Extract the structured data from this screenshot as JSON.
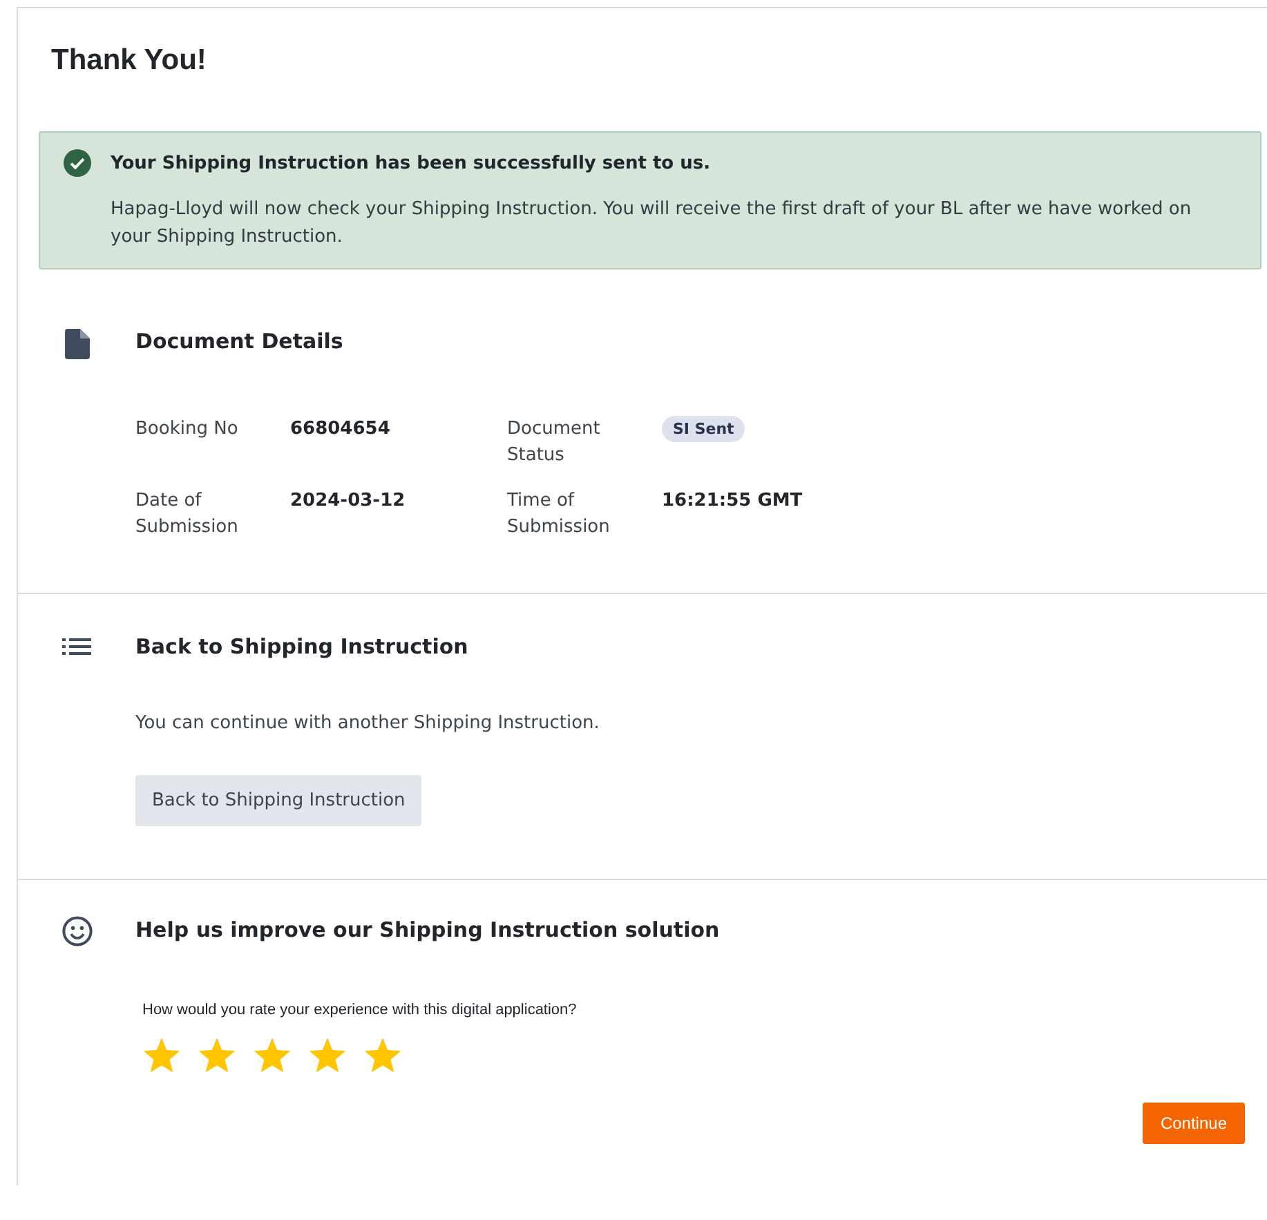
{
  "title": "Thank You!",
  "alert": {
    "heading": "Your Shipping Instruction has been successfully sent to us.",
    "message": "Hapag-Lloyd will now check your Shipping Instruction. You will receive the first draft of your BL after we have worked on your Shipping Instruction."
  },
  "document_details": {
    "heading": "Document Details",
    "fields": [
      {
        "label": "Booking No",
        "value": "66804654",
        "kind": "text"
      },
      {
        "label": "Document Status",
        "value": "SI Sent",
        "kind": "badge"
      },
      {
        "label": "Date of Submission",
        "value": "2024-03-12",
        "kind": "text"
      },
      {
        "label": "Time of Submission",
        "value": "16:21:55 GMT",
        "kind": "text"
      }
    ]
  },
  "back_section": {
    "heading": "Back to Shipping Instruction",
    "text": "You can continue with another Shipping Instruction.",
    "button": "Back to Shipping Instruction"
  },
  "feedback": {
    "heading": "Help us improve our Shipping Instruction solution",
    "question": "How would you rate your experience with this digital application?",
    "stars": 5,
    "button": "Continue"
  }
}
